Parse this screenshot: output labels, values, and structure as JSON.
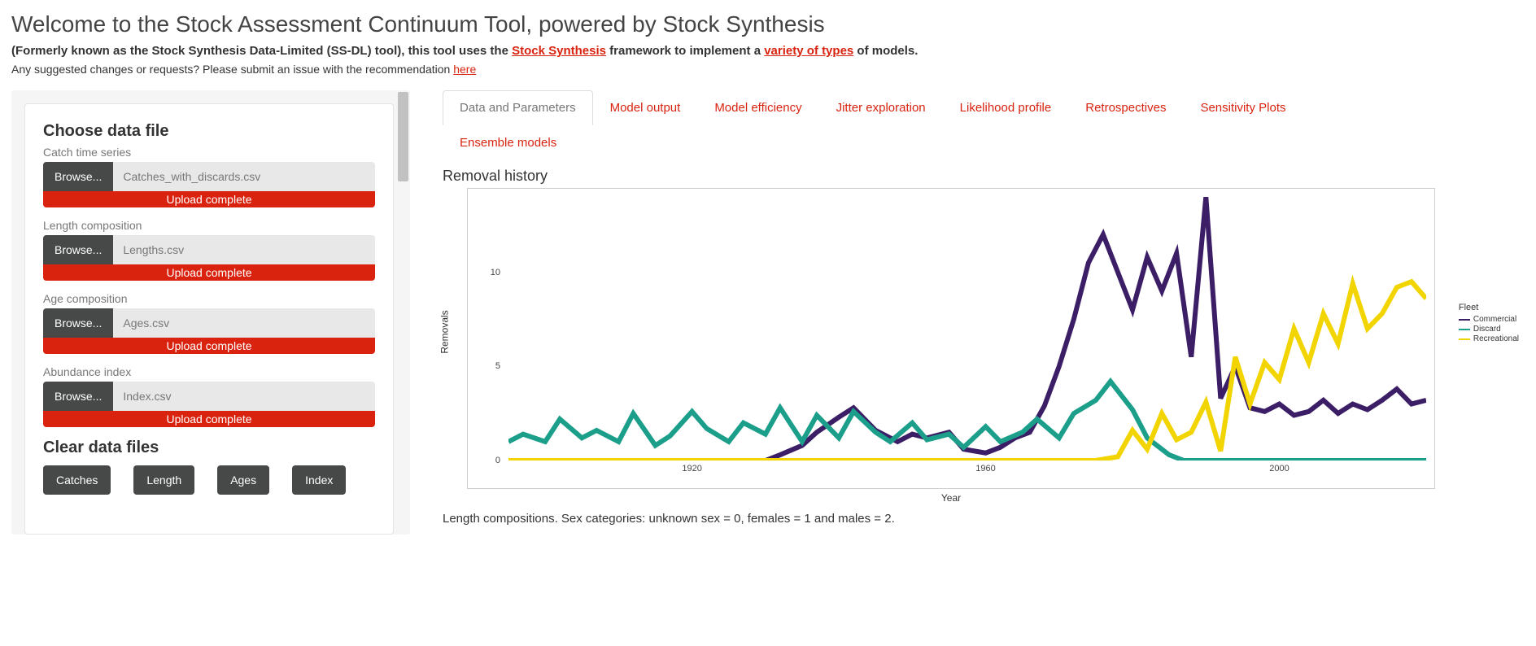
{
  "header": {
    "title": "Welcome to the Stock Assessment Continuum Tool, powered by Stock Synthesis",
    "subtitle_a": "(Formerly known as the Stock Synthesis Data-Limited (SS-DL) tool), this tool uses the ",
    "subtitle_link1": "Stock Synthesis",
    "subtitle_b": " framework to implement a ",
    "subtitle_link2": "variety of types",
    "subtitle_c": " of models.",
    "suggest_a": "Any suggested changes or requests? Please submit an issue with the recommendation ",
    "suggest_link": "here"
  },
  "sidebar": {
    "choose_title": "Choose data file",
    "fields": [
      {
        "label": "Catch time series",
        "browse": "Browse...",
        "filename": "Catches_with_discards.csv",
        "status": "Upload complete"
      },
      {
        "label": "Length composition",
        "browse": "Browse...",
        "filename": "Lengths.csv",
        "status": "Upload complete"
      },
      {
        "label": "Age composition",
        "browse": "Browse...",
        "filename": "Ages.csv",
        "status": "Upload complete"
      },
      {
        "label": "Abundance index",
        "browse": "Browse...",
        "filename": "Index.csv",
        "status": "Upload complete"
      }
    ],
    "clear_title": "Clear data files",
    "clear_buttons": [
      "Catches",
      "Length",
      "Ages",
      "Index"
    ]
  },
  "tabs": {
    "items": [
      "Data and Parameters",
      "Model output",
      "Model efficiency",
      "Jitter exploration",
      "Likelihood profile",
      "Retrospectives",
      "Sensitivity Plots",
      "Ensemble models"
    ],
    "active_index": 0
  },
  "chart_title": "Removal history",
  "caption": "Length compositions. Sex categories: unknown sex = 0, females = 1 and males = 2.",
  "chart_data": {
    "type": "line",
    "title": "Removal history",
    "xlabel": "Year",
    "ylabel": "Removals",
    "xlim": [
      1895,
      2020
    ],
    "ylim": [
      0,
      14
    ],
    "x_ticks": [
      1920,
      1960,
      2000
    ],
    "y_ticks": [
      0,
      5,
      10
    ],
    "legend_title": "Fleet",
    "legend_position": "right",
    "series": [
      {
        "name": "Commercial",
        "color": "#3b1e66",
        "x": [
          1895,
          1900,
          1905,
          1910,
          1915,
          1920,
          1925,
          1930,
          1932,
          1935,
          1937,
          1940,
          1942,
          1945,
          1948,
          1950,
          1952,
          1955,
          1957,
          1960,
          1962,
          1964,
          1966,
          1968,
          1970,
          1972,
          1974,
          1976,
          1978,
          1980,
          1982,
          1984,
          1986,
          1988,
          1990,
          1992,
          1994,
          1996,
          1998,
          2000,
          2002,
          2004,
          2006,
          2008,
          2010,
          2012,
          2014,
          2016,
          2018,
          2020
        ],
        "values": [
          0.0,
          0.0,
          0.0,
          0.0,
          0.0,
          0.0,
          0.0,
          0.0,
          0.3,
          0.8,
          1.5,
          2.3,
          2.8,
          1.6,
          1.0,
          1.4,
          1.2,
          1.5,
          0.6,
          0.4,
          0.7,
          1.2,
          1.5,
          2.9,
          5.0,
          7.5,
          10.5,
          12.0,
          10.0,
          8.0,
          10.8,
          9.0,
          11.0,
          5.5,
          14.0,
          3.3,
          5.0,
          2.8,
          2.6,
          3.0,
          2.4,
          2.6,
          3.2,
          2.5,
          3.0,
          2.7,
          3.2,
          3.8,
          3.0,
          3.2
        ]
      },
      {
        "name": "Discard",
        "color": "#1b9e8a",
        "x": [
          1895,
          1897,
          1900,
          1902,
          1905,
          1907,
          1910,
          1912,
          1915,
          1917,
          1920,
          1922,
          1925,
          1927,
          1930,
          1932,
          1935,
          1937,
          1940,
          1942,
          1945,
          1947,
          1950,
          1952,
          1955,
          1957,
          1960,
          1962,
          1965,
          1967,
          1970,
          1972,
          1975,
          1977,
          1980,
          1982,
          1985,
          1987,
          1990,
          1992,
          1995,
          2000,
          2005,
          2010,
          2015,
          2020
        ],
        "values": [
          1.0,
          1.4,
          1.0,
          2.2,
          1.2,
          1.6,
          1.0,
          2.5,
          0.8,
          1.3,
          2.6,
          1.7,
          1.0,
          2.0,
          1.4,
          2.8,
          1.0,
          2.4,
          1.2,
          2.6,
          1.5,
          1.0,
          2.0,
          1.1,
          1.4,
          0.7,
          1.8,
          1.0,
          1.5,
          2.2,
          1.2,
          2.5,
          3.2,
          4.2,
          2.7,
          1.2,
          0.3,
          0.0,
          0.0,
          0.0,
          0.0,
          0.0,
          0.0,
          0.0,
          0.0,
          0.0
        ]
      },
      {
        "name": "Recreational",
        "color": "#f2d500",
        "x": [
          1895,
          1930,
          1960,
          1975,
          1978,
          1980,
          1982,
          1984,
          1986,
          1988,
          1990,
          1992,
          1994,
          1996,
          1998,
          2000,
          2002,
          2004,
          2006,
          2008,
          2010,
          2012,
          2014,
          2016,
          2018,
          2020
        ],
        "values": [
          0.0,
          0.0,
          0.0,
          0.0,
          0.2,
          1.6,
          0.6,
          2.5,
          1.1,
          1.5,
          3.1,
          0.5,
          5.5,
          3.0,
          5.2,
          4.3,
          7.0,
          5.2,
          7.8,
          6.2,
          9.4,
          7.0,
          7.8,
          9.2,
          9.5,
          8.6
        ]
      }
    ]
  }
}
